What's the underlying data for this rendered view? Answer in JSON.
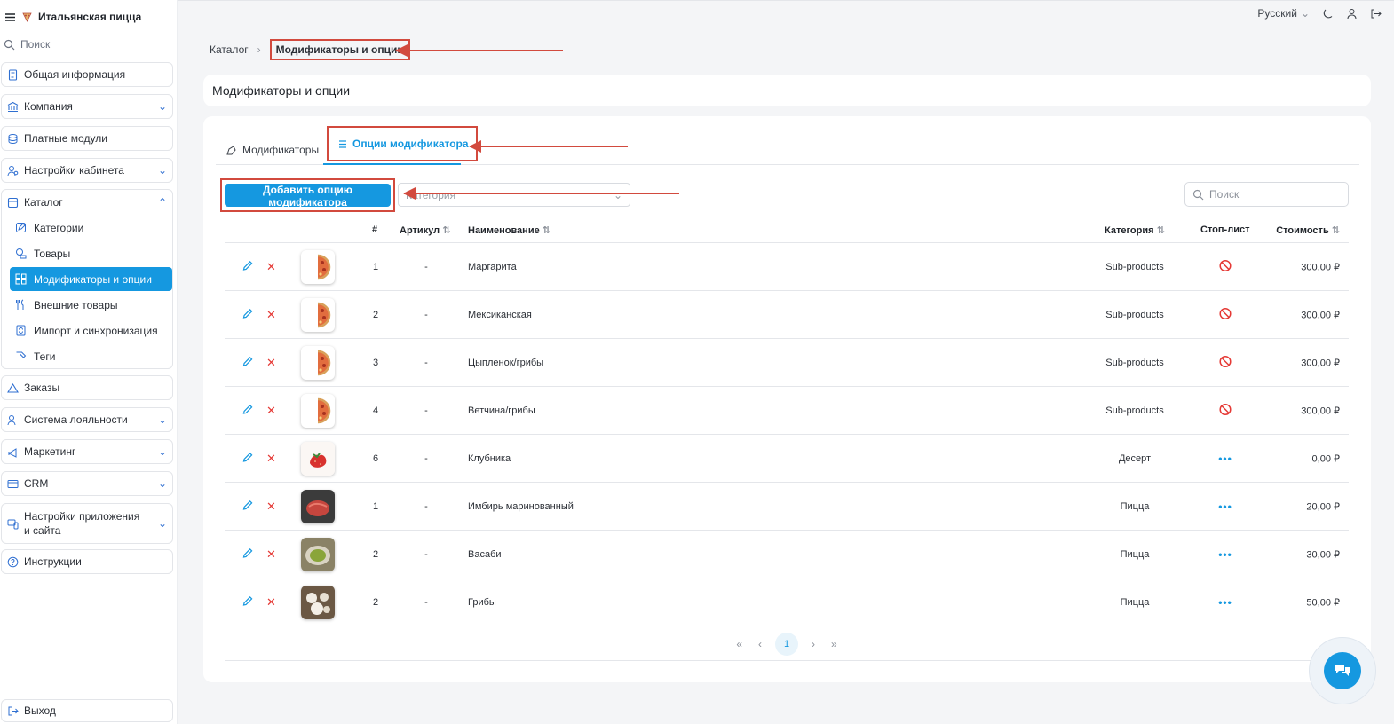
{
  "app": {
    "title": "Итальянская пицца"
  },
  "sidebar": {
    "search_placeholder": "Поиск",
    "items": [
      {
        "label": "Общая информация",
        "icon": "document-icon"
      },
      {
        "label": "Компания",
        "icon": "bank-icon"
      },
      {
        "label": "Платные модули",
        "icon": "coins-icon"
      },
      {
        "label": "Настройки кабинета",
        "icon": "settings-icon"
      },
      {
        "label": "Каталог",
        "icon": "catalog-icon"
      },
      {
        "label": "Заказы",
        "icon": "orders-icon"
      },
      {
        "label": "Система лояльности",
        "icon": "loyalty-icon"
      },
      {
        "label": "Маркетинг",
        "icon": "marketing-icon"
      },
      {
        "label": "CRM",
        "icon": "crm-icon"
      },
      {
        "label": "Настройки приложения и сайта",
        "icon": "app-settings-icon"
      },
      {
        "label": "Инструкции",
        "icon": "help-icon"
      }
    ],
    "catalog_sub": [
      {
        "label": "Категории"
      },
      {
        "label": "Товары"
      },
      {
        "label": "Модификаторы и опции"
      },
      {
        "label": "Внешние товары"
      },
      {
        "label": "Импорт и синхронизация"
      },
      {
        "label": "Теги"
      }
    ],
    "logout_label": "Выход"
  },
  "topbar": {
    "language": "Русский"
  },
  "breadcrumb": {
    "catalog": "Каталог",
    "current": "Модификаторы и опции"
  },
  "page": {
    "title": "Модификаторы и опции"
  },
  "tabs": {
    "modifiers": "Модификаторы",
    "options": "Опции модификатора"
  },
  "toolbar": {
    "add_label": "Добавить опцию модификатора",
    "category_placeholder": "Категория",
    "search_placeholder": "Поиск"
  },
  "table": {
    "headers": {
      "num": "#",
      "article": "Артикул",
      "name": "Наименование",
      "category": "Категория",
      "stop": "Стоп-лист",
      "price": "Стоимость"
    },
    "rows": [
      {
        "num": "1",
        "article": "-",
        "name": "Маргарита",
        "category": "Sub-products",
        "stop": true,
        "price": "300,00 ₽",
        "img": "pizza"
      },
      {
        "num": "2",
        "article": "-",
        "name": "Мексиканская",
        "category": "Sub-products",
        "stop": true,
        "price": "300,00 ₽",
        "img": "pizza"
      },
      {
        "num": "3",
        "article": "-",
        "name": "Цыпленок/грибы",
        "category": "Sub-products",
        "stop": true,
        "price": "300,00 ₽",
        "img": "pizza"
      },
      {
        "num": "4",
        "article": "-",
        "name": "Ветчина/грибы",
        "category": "Sub-products",
        "stop": true,
        "price": "300,00 ₽",
        "img": "pizza"
      },
      {
        "num": "6",
        "article": "-",
        "name": "Клубника",
        "category": "Десерт",
        "stop": false,
        "price": "0,00 ₽",
        "img": "strawberry"
      },
      {
        "num": "1",
        "article": "-",
        "name": "Имбирь маринованный",
        "category": "Пицца",
        "stop": false,
        "price": "20,00 ₽",
        "img": "ginger"
      },
      {
        "num": "2",
        "article": "-",
        "name": "Васаби",
        "category": "Пицца",
        "stop": false,
        "price": "30,00 ₽",
        "img": "wasabi"
      },
      {
        "num": "2",
        "article": "-",
        "name": "Грибы",
        "category": "Пицца",
        "stop": false,
        "price": "50,00 ₽",
        "img": "mushrooms"
      }
    ]
  },
  "pagination": {
    "first": "«",
    "prev": "‹",
    "current": "1",
    "next": "›",
    "last": "»"
  },
  "colors": {
    "accent": "#1598e0",
    "annotation": "#d24a3e",
    "danger": "#e53935"
  }
}
